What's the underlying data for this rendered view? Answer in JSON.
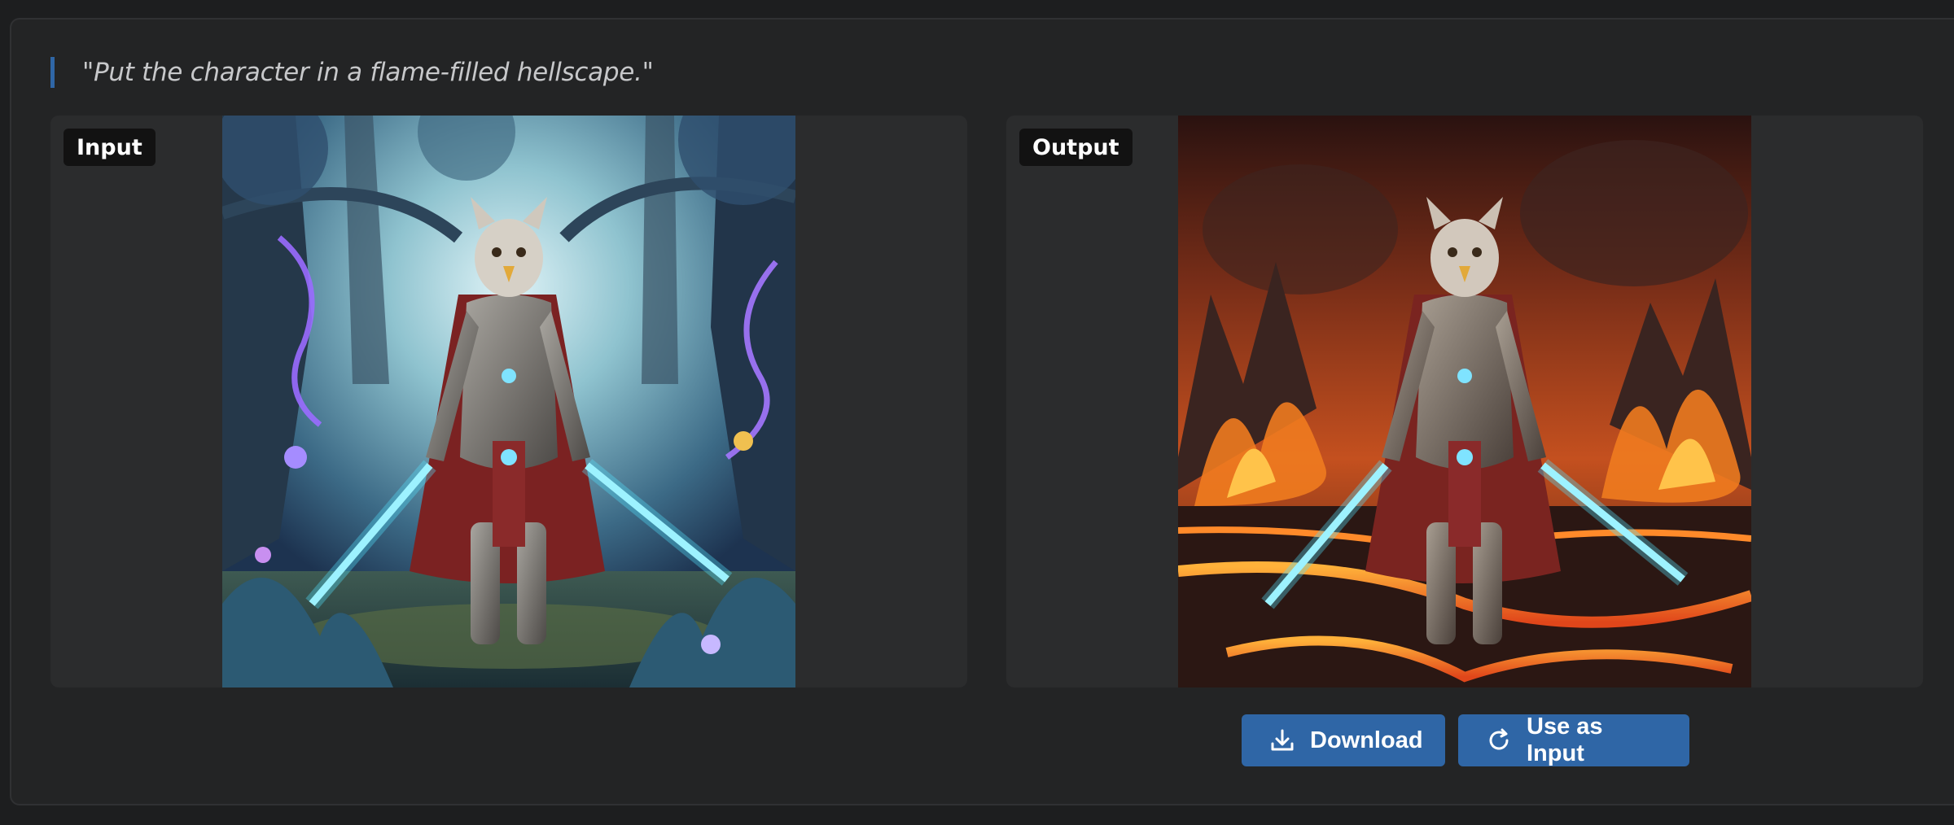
{
  "prompt": {
    "text": "\"Put the character in a flame-filled hellscape.\""
  },
  "input_panel": {
    "label": "Input",
    "image_description": "armored owl warrior with two glowing blue swords in an enchanted blue forest"
  },
  "output_panel": {
    "label": "Output",
    "image_description": "armored owl warrior with two glowing blue swords in a fiery lava hellscape"
  },
  "actions": {
    "download_label": "Download",
    "download_icon": "download-icon",
    "use_as_input_label": "Use as Input",
    "use_as_input_icon": "refresh-icon"
  },
  "colors": {
    "accent": "#2f66a6",
    "background": "#1d1e1f",
    "panel": "#2b2c2d",
    "badge": "#121212"
  }
}
